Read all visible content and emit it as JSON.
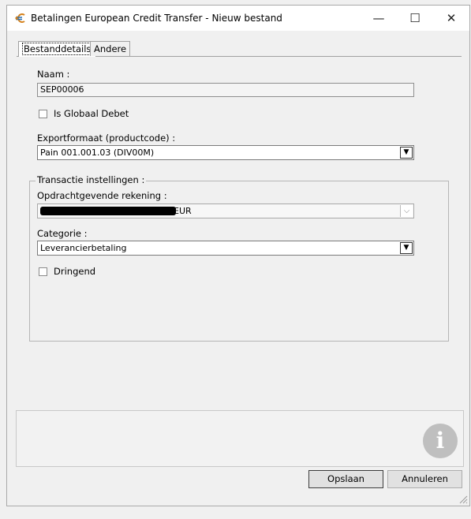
{
  "window": {
    "title": "Betalingen European Credit Transfer - Nieuw bestand",
    "minimize_glyph": "—",
    "maximize_glyph": "☐",
    "close_glyph": "✕"
  },
  "tabs": [
    {
      "label": "Bestanddetails",
      "active": true
    },
    {
      "label": "Andere",
      "active": false
    }
  ],
  "form": {
    "name_label": "Naam :",
    "name_value": "SEP00006",
    "global_debit_label": "Is Globaal Debet",
    "global_debit_checked": false,
    "export_format_label": "Exportformaat (productcode) :",
    "export_format_value": "Pain 001.001.03 (DIV00M)",
    "transaction_group_title": "Transactie instellingen :",
    "ordering_account_label": "Opdrachtgevende rekening :",
    "ordering_account_value_suffix": "EUR",
    "category_label": "Categorie :",
    "category_value": "Leverancierbetaling",
    "urgent_label": "Dringend",
    "urgent_checked": false
  },
  "icons": {
    "app": "euro-arrow-icon",
    "info": "info-icon",
    "info_glyph": "i",
    "dropdown_glyph": "▼",
    "dropdown_light_glyph": "⌵"
  },
  "buttons": {
    "save_label": "Opslaan",
    "cancel_label": "Annuleren"
  }
}
